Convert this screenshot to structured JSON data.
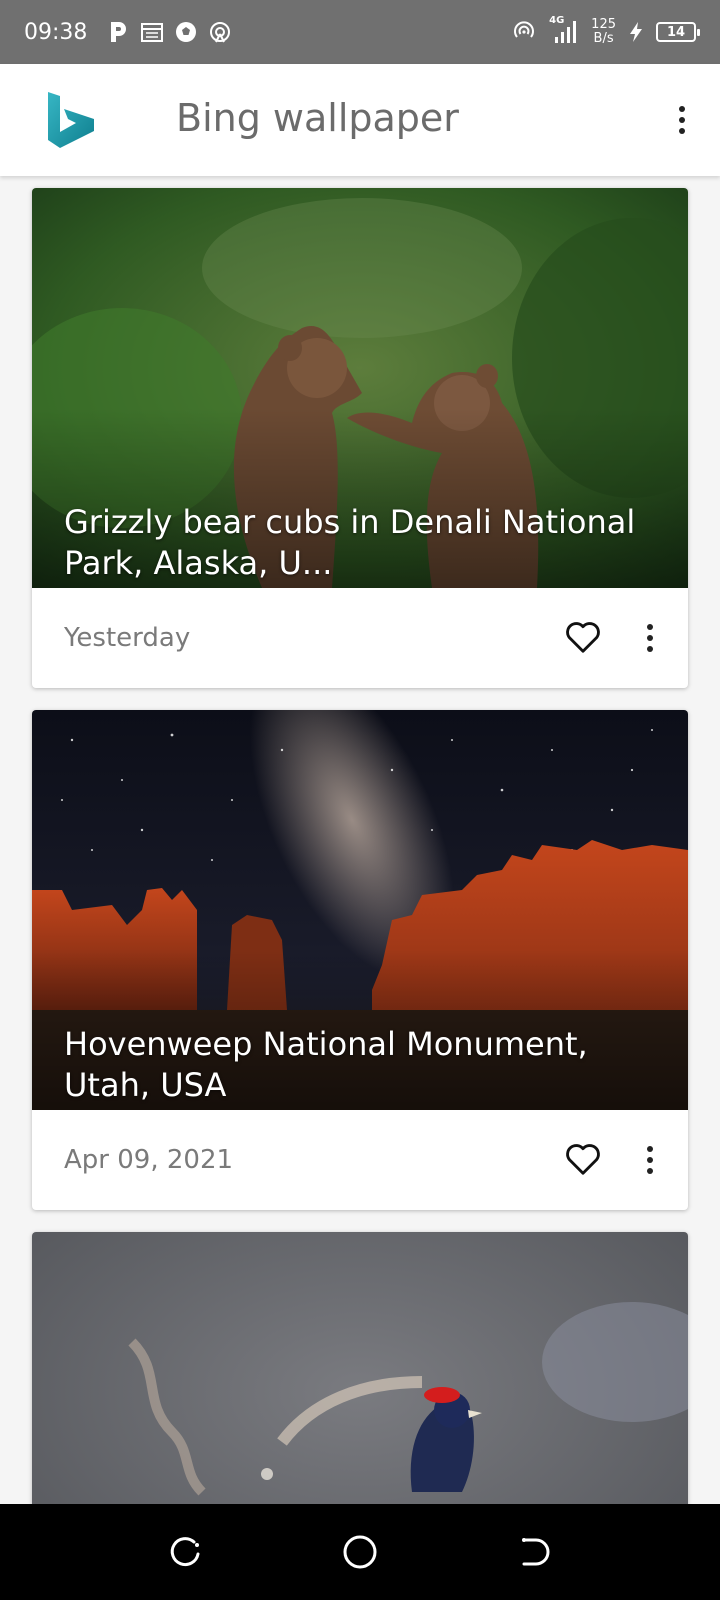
{
  "status_bar": {
    "time": "09:38",
    "left_icons": [
      "parking-icon",
      "calendar-icon",
      "soccer-icon",
      "hotspot-icon"
    ],
    "right_icons": [
      "hotspot-signal-icon",
      "4g-signal-icon"
    ],
    "network_label": "4G",
    "net_speed_value": "125",
    "net_speed_unit": "B/s",
    "battery_level": "14"
  },
  "app_bar": {
    "title": "Bing wallpaper",
    "logo_color": "#1a9aa8",
    "menu_icon": "more-vert-icon"
  },
  "cards": [
    {
      "caption": "Grizzly bear cubs in Denali National Park, Alaska, U...",
      "date": "Yesterday",
      "favorite_icon": "heart-outline-icon",
      "more_icon": "more-vert-icon"
    },
    {
      "caption": "Hovenweep National Monument, Utah, USA",
      "date": "Apr 09, 2021",
      "favorite_icon": "heart-outline-icon",
      "more_icon": "more-vert-icon"
    },
    {
      "caption": "",
      "date": ""
    }
  ],
  "nav_bar": {
    "buttons": [
      "recents-icon",
      "home-icon",
      "back-icon"
    ]
  }
}
